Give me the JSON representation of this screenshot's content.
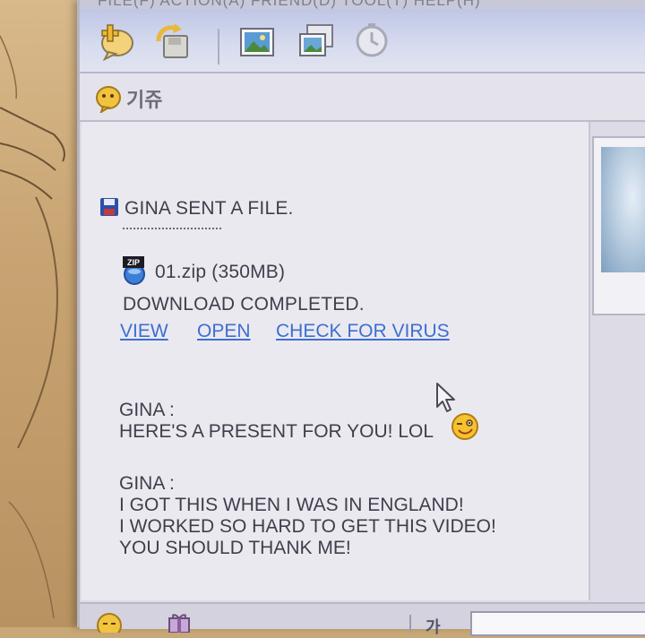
{
  "menubar": {
    "text": "FILE(F)   ACTION(A)   FRIEND(D)   TOOL(T)   HELP(H)"
  },
  "toolbar": {
    "icons": [
      "add-chat-icon",
      "save-icon",
      "picture-icon",
      "gallery-icon",
      "clock-icon"
    ]
  },
  "subbar": {
    "label": "기쥬"
  },
  "chat": {
    "file_notice": "GINA SENT A FILE.",
    "file_name": "01.zip (350MB)",
    "zip_badge": "ZIP",
    "download_status": "DOWNLOAD COMPLETED.",
    "links": {
      "view": "VIEW",
      "open": "OPEN",
      "check_virus": "CHECK FOR VIRUS"
    },
    "messages": [
      {
        "sender": "GINA :",
        "lines": [
          "HERE'S A PRESENT FOR YOU! LOL"
        ]
      },
      {
        "sender": "GINA :",
        "lines": [
          "I GOT THIS WHEN I WAS IN ENGLAND!",
          "I WORKED SO HARD TO GET THIS VIDEO!",
          "YOU SHOULD THANK ME!"
        ]
      }
    ]
  },
  "bottombar": {
    "text": "가"
  },
  "colors": {
    "link": "#3d6fd0",
    "toolbar": "#bfc6e6",
    "chat_bg": "#ebe9f0",
    "text": "#3f3f4c"
  }
}
